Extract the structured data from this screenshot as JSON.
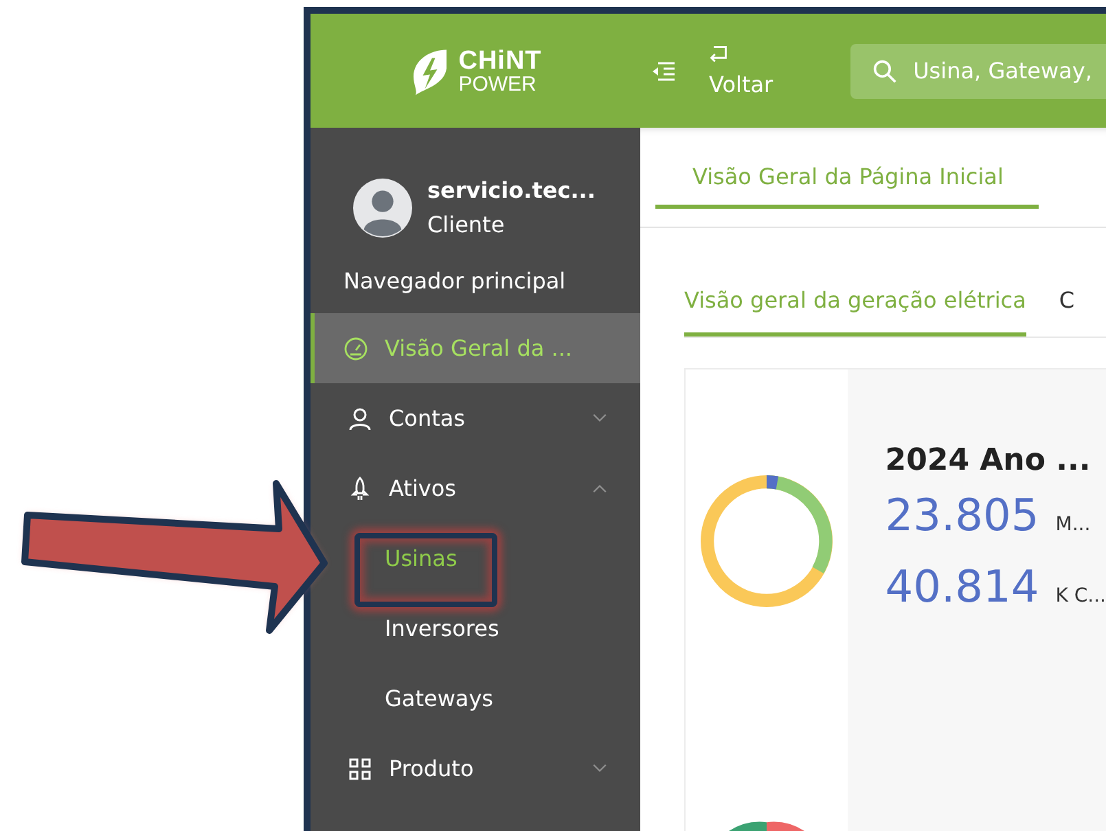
{
  "header": {
    "logo": {
      "line_1": "CHiNT",
      "line_2": "POWER"
    },
    "back_button": {
      "label": "Voltar"
    },
    "search": {
      "placeholder": "Usina, Gateway,"
    }
  },
  "sidebar": {
    "user": {
      "name": "servicio.tec...",
      "role": "Cliente"
    },
    "heading": "Navegador principal",
    "items": [
      {
        "kind": "link",
        "label": "Visão Geral da ...",
        "selected": true
      },
      {
        "kind": "group",
        "label": "Contas",
        "selected": false,
        "expanded": false
      },
      {
        "kind": "group",
        "label": "Ativos",
        "selected": false,
        "expanded": true,
        "children": [
          {
            "label": "Usinas",
            "selected": true
          },
          {
            "label": "Inversores",
            "selected": false
          },
          {
            "label": "Gateways",
            "selected": false
          }
        ]
      },
      {
        "kind": "group",
        "label": "Produto",
        "selected": false,
        "expanded": false
      }
    ]
  },
  "tabs": [
    {
      "label": "Visão Geral da Página Inicial",
      "selected": true
    }
  ],
  "subtabs": [
    {
      "label": "Visão geral da geração elétrica",
      "selected": true
    },
    {
      "label": "C",
      "selected": false
    }
  ],
  "card": {
    "title": "2024 Ano ...",
    "stats": [
      {
        "value": "23.805",
        "unit": "M..."
      },
      {
        "value": "40.814",
        "unit": "K C..."
      }
    ]
  }
}
